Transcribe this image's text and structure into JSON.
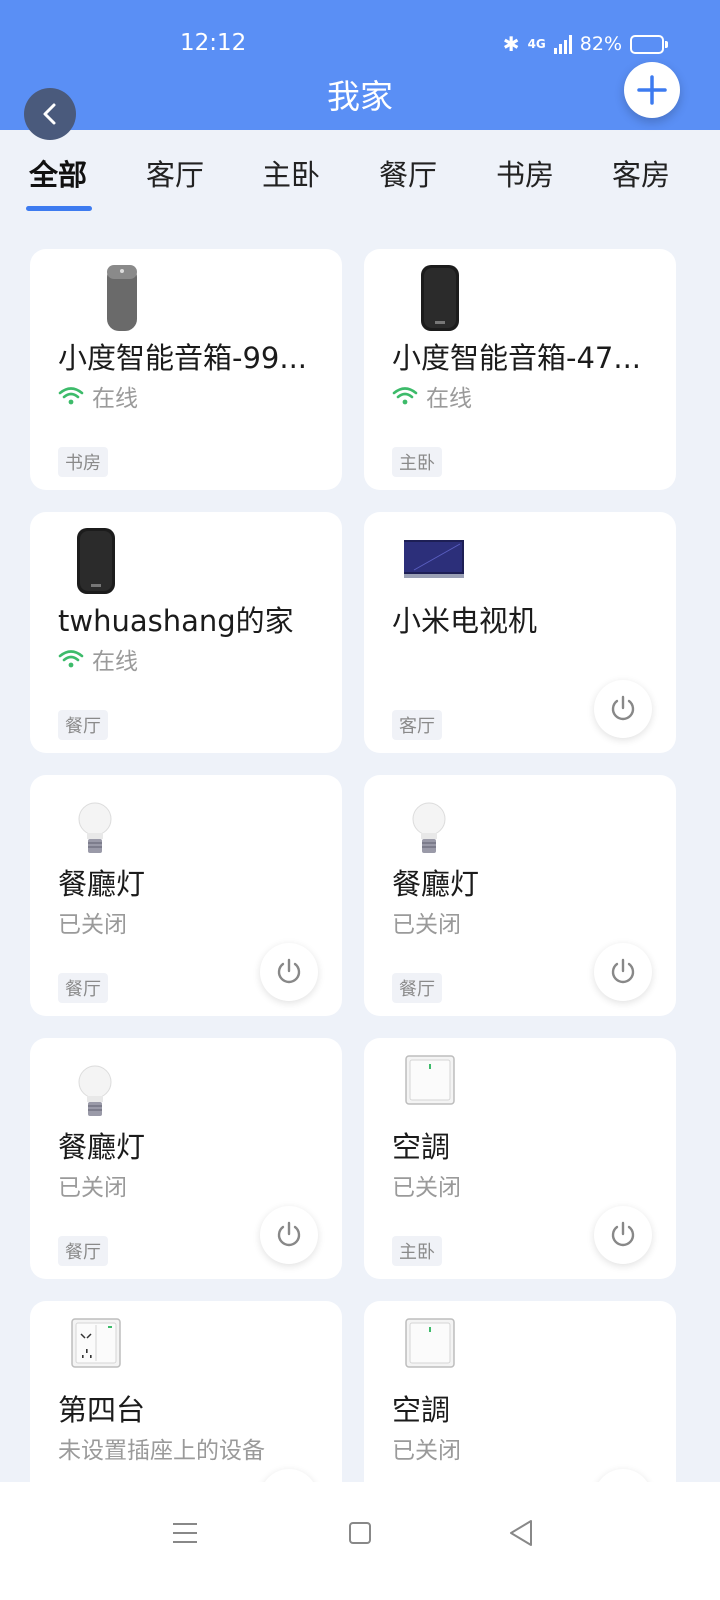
{
  "status_bar": {
    "time": "12:12",
    "network": "4G",
    "battery": "82%",
    "battery_level": 0.82
  },
  "header": {
    "title": "我家"
  },
  "tabs": [
    {
      "label": "全部",
      "active": true
    },
    {
      "label": "客厅"
    },
    {
      "label": "主卧"
    },
    {
      "label": "餐厅"
    },
    {
      "label": "书房"
    },
    {
      "label": "客房"
    }
  ],
  "devices": [
    {
      "name": "小度智能音箱-99...",
      "status": "在线",
      "room": "书房",
      "icon": "gray-speaker-icon",
      "online": true
    },
    {
      "name": "小度智能音箱-47...",
      "status": "在线",
      "room": "主卧",
      "icon": "black-speaker-icon",
      "online": true
    },
    {
      "name": "twhuashang的家",
      "status": "在线",
      "room": "餐厅",
      "icon": "black-speaker-icon",
      "online": true
    },
    {
      "name": "小米电视机",
      "status": "",
      "room": "客厅",
      "icon": "tv-icon",
      "power": true
    },
    {
      "name": "餐廳灯",
      "status": "已关闭",
      "room": "餐厅",
      "icon": "light-bulb-icon",
      "power": true
    },
    {
      "name": "餐廳灯",
      "status": "已关闭",
      "room": "餐厅",
      "icon": "light-bulb-icon",
      "power": true
    },
    {
      "name": "餐廳灯",
      "status": "已关闭",
      "room": "餐厅",
      "icon": "light-bulb-icon",
      "power": true
    },
    {
      "name": "空調",
      "status": "已关闭",
      "room": "主卧",
      "icon": "wall-switch-icon",
      "power": true
    },
    {
      "name": "第四台",
      "status": "未设置插座上的设备",
      "room": "",
      "icon": "wall-socket-icon",
      "power": true
    },
    {
      "name": "空調",
      "status": "已关闭",
      "room": "",
      "icon": "wall-switch-icon",
      "power": true
    }
  ],
  "colors": {
    "header": "#5a8ff5",
    "accent": "#3d7bf0",
    "online": "#3dbb6a",
    "background": "#eef2f9"
  }
}
